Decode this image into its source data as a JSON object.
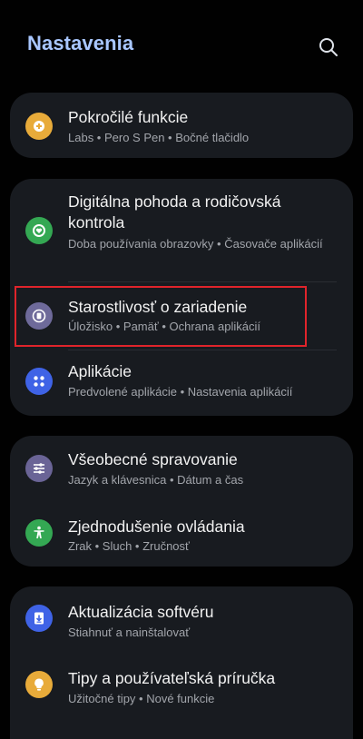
{
  "header": {
    "title": "Nastavenia"
  },
  "items": [
    {
      "title": "Pokročilé funkcie",
      "subtitle": "Labs • Pero S Pen • Bočné tlačidlo",
      "icon": "gear-plus-icon",
      "color": "#e8ab3a"
    },
    {
      "title": "Digitálna pohoda a rodičovská kontrola",
      "subtitle": "Doba používania obrazovky • Časovače aplikácií",
      "icon": "heart-icon",
      "color": "#34a853"
    },
    {
      "title": "Starostlivosť o zariadenie",
      "subtitle": "Úložisko • Pamäť • Ochrana aplikácií",
      "icon": "device-care-icon",
      "color": "#6e6a9a"
    },
    {
      "title": "Aplikácie",
      "subtitle": "Predvolené aplikácie • Nastavenia aplikácií",
      "icon": "apps-grid-icon",
      "color": "#3f63e6"
    },
    {
      "title": "Všeobecné spravovanie",
      "subtitle": "Jazyk a klávesnica • Dátum a čas",
      "icon": "sliders-icon",
      "color": "#6a6496"
    },
    {
      "title": "Zjednodušenie ovládania",
      "subtitle": "Zrak • Sluch • Zručnosť",
      "icon": "accessibility-icon",
      "color": "#34a853"
    },
    {
      "title": "Aktualizácia softvéru",
      "subtitle": "Stiahnuť a nainštalovať",
      "icon": "software-update-icon",
      "color": "#3f63e6"
    },
    {
      "title": "Tipy a používateľská príručka",
      "subtitle": "Užitočné tipy • Nové funkcie",
      "icon": "lightbulb-icon",
      "color": "#e8ab3a"
    }
  ]
}
